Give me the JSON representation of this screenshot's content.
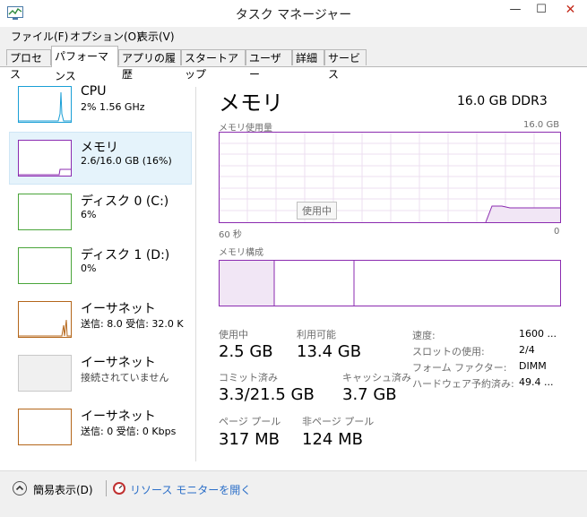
{
  "window": {
    "title": "タスク マネージャー",
    "minimize": "—",
    "maximize": "☐",
    "close": "✕"
  },
  "menu": [
    "ファイル(F)",
    "オプション(O)",
    "表示(V)"
  ],
  "tabs": [
    "プロセス",
    "パフォーマンス",
    "アプリの履歴",
    "スタートアップ",
    "ユーザー",
    "詳細",
    "サービス"
  ],
  "active_tab": 1,
  "sidebar": {
    "items": [
      {
        "title": "CPU",
        "sub": "2% 1.56 GHz",
        "color": "#1a9fd6"
      },
      {
        "title": "メモリ",
        "sub": "2.6/16.0 GB (16%)",
        "color": "#8b2bb0"
      },
      {
        "title": "ディスク 0 (C:)",
        "sub": "6%",
        "color": "#4aa53a"
      },
      {
        "title": "ディスク 1 (D:)",
        "sub": "0%",
        "color": "#4aa53a"
      },
      {
        "title": "イーサネット",
        "sub": "送信: 8.0  受信: 32.0 K",
        "color": "#b4661a"
      },
      {
        "title": "イーサネット",
        "sub": "接続されていません",
        "color": "#c8c8c8"
      },
      {
        "title": "イーサネット",
        "sub": "送信: 0  受信: 0 Kbps",
        "color": "#b4661a"
      }
    ]
  },
  "main": {
    "title": "メモリ",
    "capacity": "16.0 GB DDR3",
    "usage_label": "メモリ使用量",
    "usage_max": "16.0 GB",
    "tooltip": "使用中",
    "axis_left": "60 秒",
    "axis_right": "0",
    "composition_label": "メモリ構成",
    "accent": "#8b2bb0",
    "stats": {
      "in_use_label": "使用中",
      "in_use": "2.5 GB",
      "available_label": "利用可能",
      "available": "13.4 GB",
      "committed_label": "コミット済み",
      "committed": "3.3/21.5 GB",
      "cached_label": "キャッシュ済み",
      "cached": "3.7 GB",
      "paged_label": "ページ プール",
      "paged": "317 MB",
      "nonpaged_label": "非ページ プール",
      "nonpaged": "124 MB"
    },
    "details": {
      "speed_label": "速度:",
      "speed": "1600 ...",
      "slots_label": "スロットの使用:",
      "slots": "2/4",
      "form_label": "フォーム ファクター:",
      "form": "DIMM",
      "reserved_label": "ハードウェア予約済み:",
      "reserved": "49.4 ..."
    }
  },
  "footer": {
    "fewer": "簡易表示(D)",
    "resmon": "リソース モニターを開く"
  }
}
